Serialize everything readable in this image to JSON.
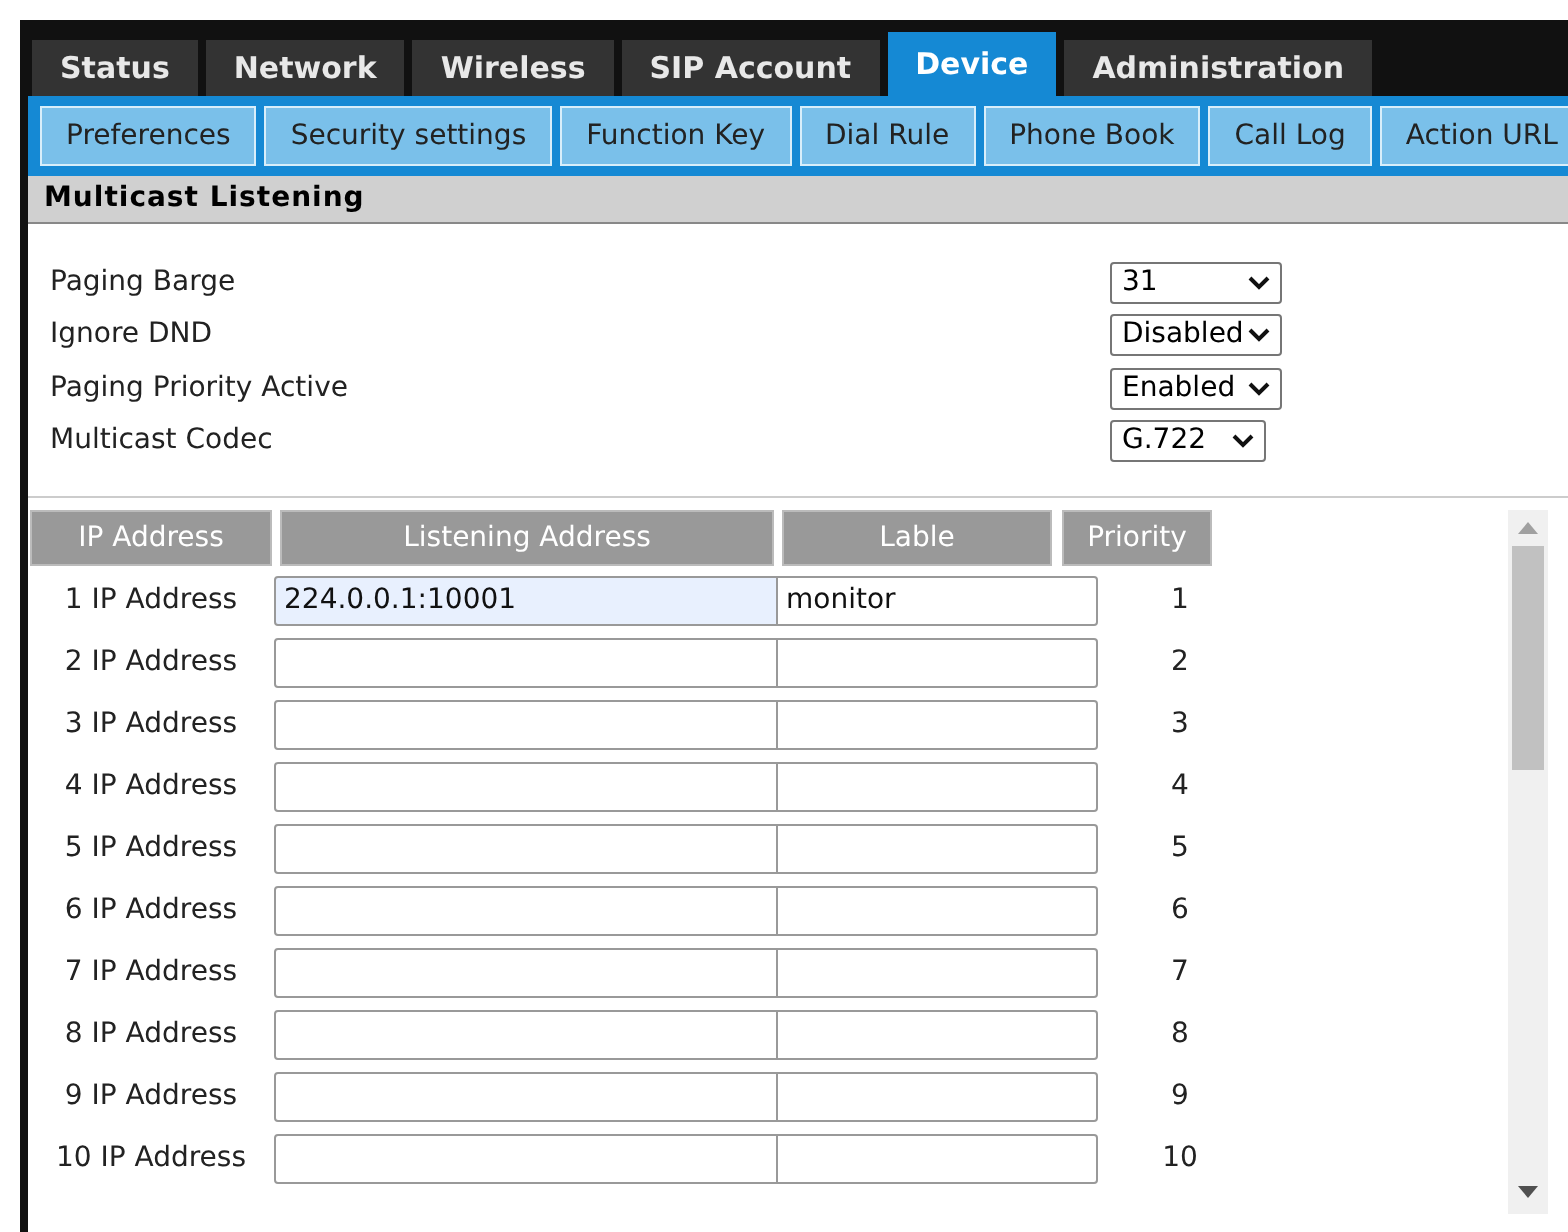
{
  "tabs": [
    {
      "label": "Status",
      "selected": false
    },
    {
      "label": "Network",
      "selected": false
    },
    {
      "label": "Wireless",
      "selected": false
    },
    {
      "label": "SIP Account",
      "selected": false
    },
    {
      "label": "Device",
      "selected": true
    },
    {
      "label": "Administration",
      "selected": false
    }
  ],
  "subtabs": [
    {
      "label": "Preferences"
    },
    {
      "label": "Security settings"
    },
    {
      "label": "Function Key"
    },
    {
      "label": "Dial Rule"
    },
    {
      "label": "Phone Book"
    },
    {
      "label": "Call Log"
    },
    {
      "label": "Action URL"
    }
  ],
  "section_title": "Multicast Listening",
  "settings": [
    {
      "label": "Paging Barge",
      "value": "31"
    },
    {
      "label": "Ignore DND",
      "value": "Disabled"
    },
    {
      "label": "Paging Priority Active",
      "value": "Enabled"
    },
    {
      "label": "Multicast Codec",
      "value": "G.722"
    }
  ],
  "table": {
    "columns": [
      "IP Address",
      "Listening Address",
      "Lable",
      "Priority"
    ],
    "rows": [
      {
        "name": "1 IP Address",
        "address": "224.0.0.1:10001",
        "label": "monitor",
        "priority": "1",
        "focused": true
      },
      {
        "name": "2 IP Address",
        "priority": "2",
        "focused": false
      },
      {
        "name": "3 IP Address",
        "priority": "3",
        "focused": false
      },
      {
        "name": "4 IP Address",
        "priority": "4",
        "focused": false
      },
      {
        "name": "5 IP Address",
        "priority": "5",
        "focused": false
      },
      {
        "name": "6 IP Address",
        "priority": "6",
        "focused": false
      },
      {
        "name": "7 IP Address",
        "priority": "7",
        "focused": false
      },
      {
        "name": "8 IP Address",
        "priority": "8",
        "focused": false
      },
      {
        "name": "9 IP Address",
        "priority": "9",
        "focused": false
      },
      {
        "name": "10 IP Address",
        "priority": "10",
        "focused": false
      }
    ]
  }
}
